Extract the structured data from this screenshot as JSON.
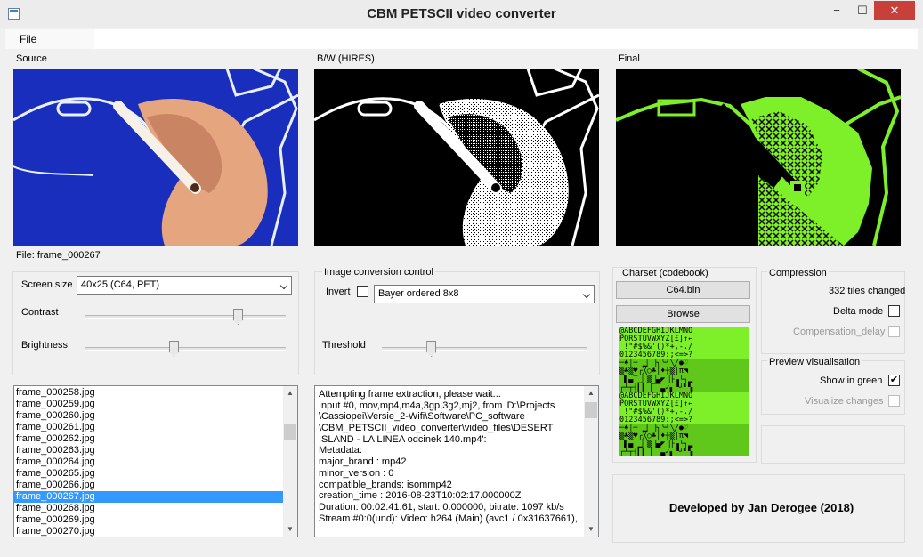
{
  "window": {
    "title": "CBM PETSCII video converter",
    "minimize": "−",
    "maximize": "☐",
    "close": "✕"
  },
  "menu": {
    "file": "File"
  },
  "source": {
    "label": "Source",
    "file_caption": "File: frame_000267"
  },
  "bw": {
    "label": "B/W (HIRES)"
  },
  "final": {
    "label": "Final"
  },
  "settings": {
    "screen_size_label": "Screen size",
    "screen_size_value": "40x25 (C64, PET)",
    "contrast_label": "Contrast",
    "brightness_label": "Brightness",
    "contrast_level": 0.76,
    "brightness_level": 0.44
  },
  "image_conversion": {
    "title": "Image conversion control",
    "invert_label": "Invert",
    "invert_checked": false,
    "dither_value": "Bayer ordered 8x8",
    "threshold_label": "Threshold",
    "threshold_level": 0.24
  },
  "charset": {
    "title": "Charset (codebook)",
    "file_button": "C64.bin",
    "browse_button": "Browse",
    "rows": [
      "@ABCDEFGHIJKLMNO",
      "PQRSTUVWXYZ[£]↑←",
      " !\"#$%&'()*+,-./",
      "0123456789:;<=>?",
      "─♠│─▔▁▏▕╮╰╯╲╱●♡",
      "▒♣▒♥╭╳○♣│♦┼▒│π◥",
      " ▌▄▔▁▏▒▕▄◤▕├▗└┐▂",
      "┌┴┬┤▎▍▕▔▔▃✓▖▝┘▘▚",
      "@ABCDEFGHIJKLMNO",
      "PQRSTUVWXYZ[£]↑←",
      " !\"#$%&'()*+,-./",
      "0123456789:;<=>?",
      "─♠│─▔▁▏▕╮╰╯╲╱●♡",
      "▒♣▒♥╭╳○♣│♦┼▒│π◥",
      " ▌▄▔▁▏▒▕▄◤▕├▗└┐▂",
      "┌┴┬┤▎▍▕▔▔▃✓▖▝┘▘▚"
    ]
  },
  "compression": {
    "title": "Compression",
    "tiles_changed": "332 tiles changed",
    "delta_label": "Delta mode",
    "delta_checked": false,
    "compensation_label": "Compensation_delay",
    "compensation_checked": false
  },
  "preview": {
    "title": "Preview visualisation",
    "show_green_label": "Show in green",
    "show_green_checked": true,
    "visualize_label": "Visualize changes",
    "visualize_checked": false
  },
  "frames": {
    "items": [
      "frame_000258.jpg",
      "frame_000259.jpg",
      "frame_000260.jpg",
      "frame_000261.jpg",
      "frame_000262.jpg",
      "frame_000263.jpg",
      "frame_000264.jpg",
      "frame_000265.jpg",
      "frame_000266.jpg",
      "frame_000267.jpg",
      "frame_000268.jpg",
      "frame_000269.jpg",
      "frame_000270.jpg"
    ],
    "selected_index": 9
  },
  "log": {
    "lines": [
      "Attempting frame extraction, please wait...",
      "Input #0, mov,mp4,m4a,3gp,3g2,mj2, from 'D:\\Projects",
      "\\Cassiopei\\Versie_2-Wifi\\Software\\PC_software",
      "\\CBM_PETSCII_video_converter\\video_files\\DESERT",
      "ISLAND - LA LINEA odcinek 140.mp4':",
      "  Metadata:",
      "    major_brand      : mp42",
      "    minor_version    : 0",
      "    compatible_brands: isommp42",
      "    creation_time    : 2016-08-23T10:02:17.000000Z",
      "  Duration: 00:02:41.61, start: 0.000000, bitrate: 1097 kb/s",
      "    Stream #0:0(und): Video: h264 (Main) (avc1 / 0x31637661),"
    ]
  },
  "credits": {
    "text": "Developed by Jan Derogee (2018)"
  },
  "colors": {
    "accent": "#3399ff",
    "petscii_green": "#7ef02a",
    "source_blue": "#1a2ebd"
  }
}
